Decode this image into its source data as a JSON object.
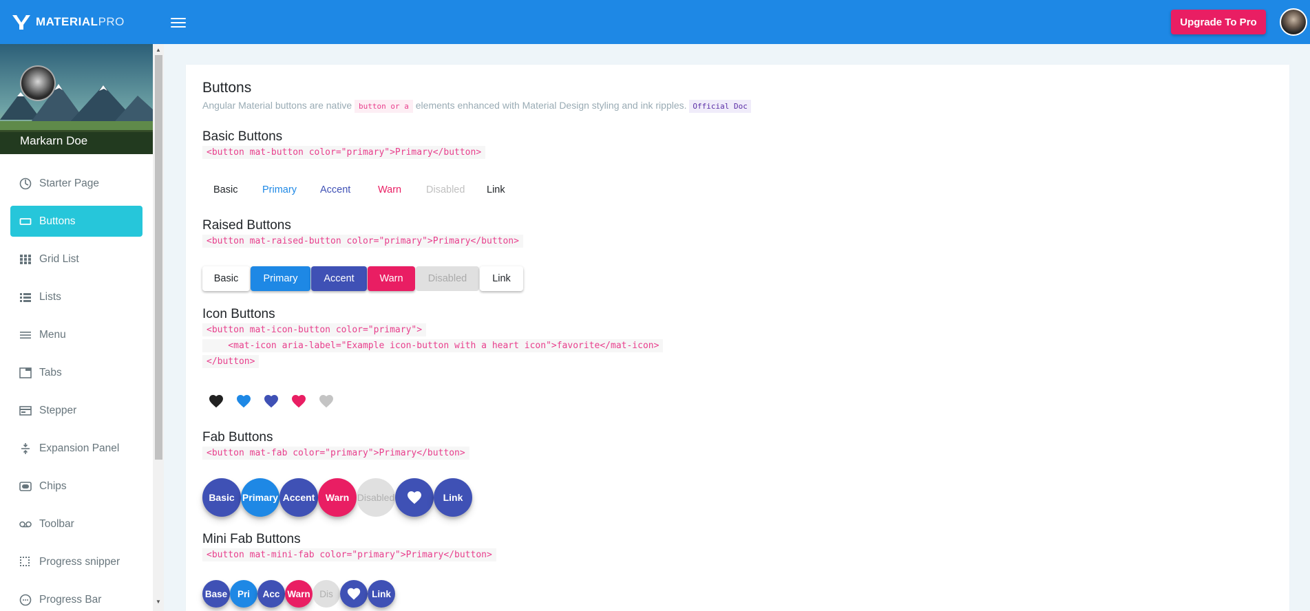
{
  "app": {
    "logo_bold": "MATERIAL",
    "logo_light": "PRO",
    "upgrade_label": "Upgrade To Pro"
  },
  "profile": {
    "name": "Markarn Doe"
  },
  "sidebar": {
    "items": [
      {
        "label": "Starter Page",
        "icon": "starter-icon"
      },
      {
        "label": "Buttons",
        "icon": "crop-icon"
      },
      {
        "label": "Grid List",
        "icon": "grid-icon"
      },
      {
        "label": "Lists",
        "icon": "list-icon"
      },
      {
        "label": "Menu",
        "icon": "menu-icon"
      },
      {
        "label": "Tabs",
        "icon": "tab-icon"
      },
      {
        "label": "Stepper",
        "icon": "stepper-icon"
      },
      {
        "label": "Expansion Panel",
        "icon": "expansion-icon"
      },
      {
        "label": "Chips",
        "icon": "chip-icon"
      },
      {
        "label": "Toolbar",
        "icon": "voicemail-icon"
      },
      {
        "label": "Progress snipper",
        "icon": "border-icon"
      },
      {
        "label": "Progress Bar",
        "icon": "progress-icon"
      }
    ]
  },
  "page": {
    "title": "Buttons",
    "subtitle_before": "Angular Material buttons are native",
    "subtitle_code": "button or a",
    "subtitle_after": "elements enhanced with Material Design styling and ink ripples.",
    "doc_label": "Official Doc"
  },
  "basic": {
    "title": "Basic Buttons",
    "code": "<button mat-button color=\"primary\">Primary</button>",
    "buttons": [
      "Basic",
      "Primary",
      "Accent",
      "Warn",
      "Disabled",
      "Link"
    ]
  },
  "raised": {
    "title": "Raised Buttons",
    "code": "<button mat-raised-button color=\"primary\">Primary</button>",
    "buttons": [
      "Basic",
      "Primary",
      "Accent",
      "Warn",
      "Disabled",
      "Link"
    ]
  },
  "icon_buttons": {
    "title": "Icon Buttons",
    "code_line1": "<button mat-icon-button color=\"primary\">",
    "code_line2": "    <mat-icon aria-label=\"Example icon-button with a heart icon\">favorite</mat-icon>",
    "code_line3": "</button>"
  },
  "fab": {
    "title": "Fab Buttons",
    "code": "<button mat-fab color=\"primary\">Primary</button>",
    "buttons": [
      "Basic",
      "Primary",
      "Accent",
      "Warn",
      "Disabled",
      "",
      "Link"
    ]
  },
  "mini_fab": {
    "title": "Mini Fab Buttons",
    "code": "<button mat-mini-fab color=\"primary\">Primary</button>",
    "buttons": [
      "Base",
      "Pri",
      "Acc",
      "Warn",
      "Dis",
      "",
      "Link"
    ]
  },
  "colors": {
    "topbar": "#1e88e5",
    "primary": "#1e88e5",
    "accent": "#3f51b5",
    "warn": "#e91e63",
    "active_nav": "#26c6da",
    "disabled": "#e0e0e0"
  }
}
